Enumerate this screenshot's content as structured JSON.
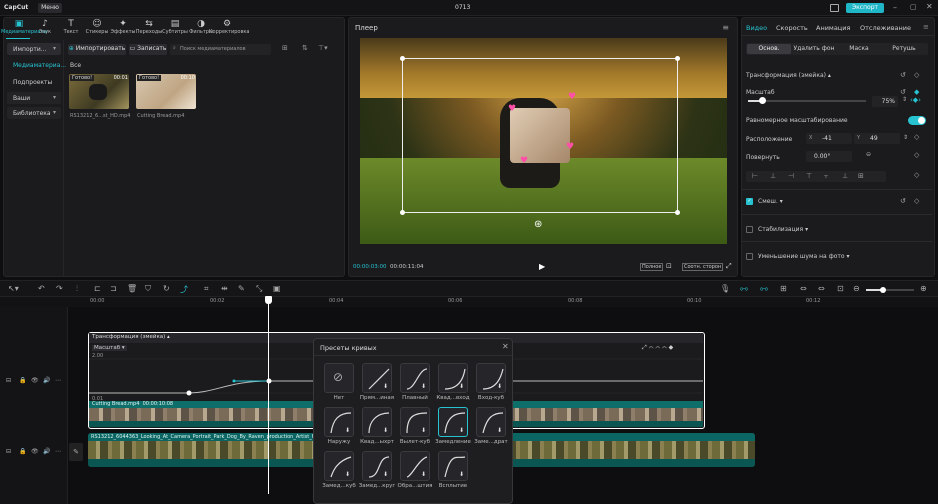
{
  "app": {
    "logo": "CapCut",
    "menu": "Меню",
    "project_title": "0713",
    "export": "Экспорт"
  },
  "toolbar": [
    {
      "label": "Медиаматериалы",
      "icon": "media-icon"
    },
    {
      "label": "Звук",
      "icon": "audio-icon"
    },
    {
      "label": "Текст",
      "icon": "text-icon"
    },
    {
      "label": "Стикеры",
      "icon": "sticker-icon"
    },
    {
      "label": "Эффекты",
      "icon": "effects-icon"
    },
    {
      "label": "Переходы",
      "icon": "transitions-icon"
    },
    {
      "label": "Субтитры",
      "icon": "captions-icon"
    },
    {
      "label": "Фильтры",
      "icon": "filters-icon"
    },
    {
      "label": "Корректировка",
      "icon": "adjust-icon"
    }
  ],
  "media": {
    "sidebar": [
      "Импорти...",
      "Медиаматериа...",
      "Подпроекты",
      "Ваши",
      "Библиотека"
    ],
    "import_btn": "Импортировать",
    "record_btn": "Записать",
    "search_placeholder": "Поиск медиаматериалов",
    "section": "Все",
    "items": [
      {
        "name": "RS13212_6...st_HD.mp4",
        "badge": "Готово!",
        "duration": "00:01"
      },
      {
        "name": "Cutting Bread.mp4",
        "badge": "Готово!",
        "duration": "00:10"
      }
    ]
  },
  "player": {
    "title": "Плеер",
    "time_current": "00:00:03:00",
    "time_total": "00:00:11:04",
    "full_btn": "Полное",
    "ratio_btn": "Соотн. сторон"
  },
  "right": {
    "tabs": [
      "Видео",
      "Скорость",
      "Анимация",
      "Отслеживание"
    ],
    "subtabs": [
      "Основ.",
      "Удалить фон",
      "Маска",
      "Ретушь"
    ],
    "transform_label": "Трансформация (змейка)",
    "scale_label": "Масштаб",
    "scale_value": "75%",
    "scale_fraction": 0.12,
    "uniform_label": "Равномерное масштабирование",
    "position_label": "Расположение",
    "pos_x_label": "X",
    "pos_x": "-41",
    "pos_y_label": "Y",
    "pos_y": "49",
    "rotate_label": "Повернуть",
    "rotate_value": "0.00°",
    "blend_label": "Смеш.",
    "stabilize_label": "Стабилизация",
    "noise_label": "Уменьшение шума на фото"
  },
  "timeline": {
    "ruler": [
      "00:00",
      "00:02",
      "00:04",
      "00:06",
      "00:08",
      "00:10",
      "00:12"
    ],
    "transform_clip_label": "Трансформация (змейка)",
    "scale_label": "Масштаб",
    "y_top": "2.00",
    "y_bottom": "0.01",
    "bread_clip": "Cutting Bread.mp4",
    "bread_duration": "00:00:10:08",
    "dog_clip": "RS13212_6044363_Looking_At_Camera_Portrait_Park_Dog_By_Raven_production_Artist_HD.mp4"
  },
  "curves": {
    "title": "Пресеты кривых",
    "presets": [
      "Нет",
      "Прям...иная",
      "Плавный",
      "Квад...вход",
      "Вход-куб",
      "Наружу",
      "Квад...ыхрт",
      "Вылет-куб",
      "Замедление",
      "Заме...драт",
      "Замед...куб",
      "Замед...круг",
      "Обра...штия",
      "Всплытие"
    ]
  },
  "colors": {
    "accent": "#27c3d0",
    "export": "#1fb6c7",
    "keyframe": "#1fb6c7"
  }
}
